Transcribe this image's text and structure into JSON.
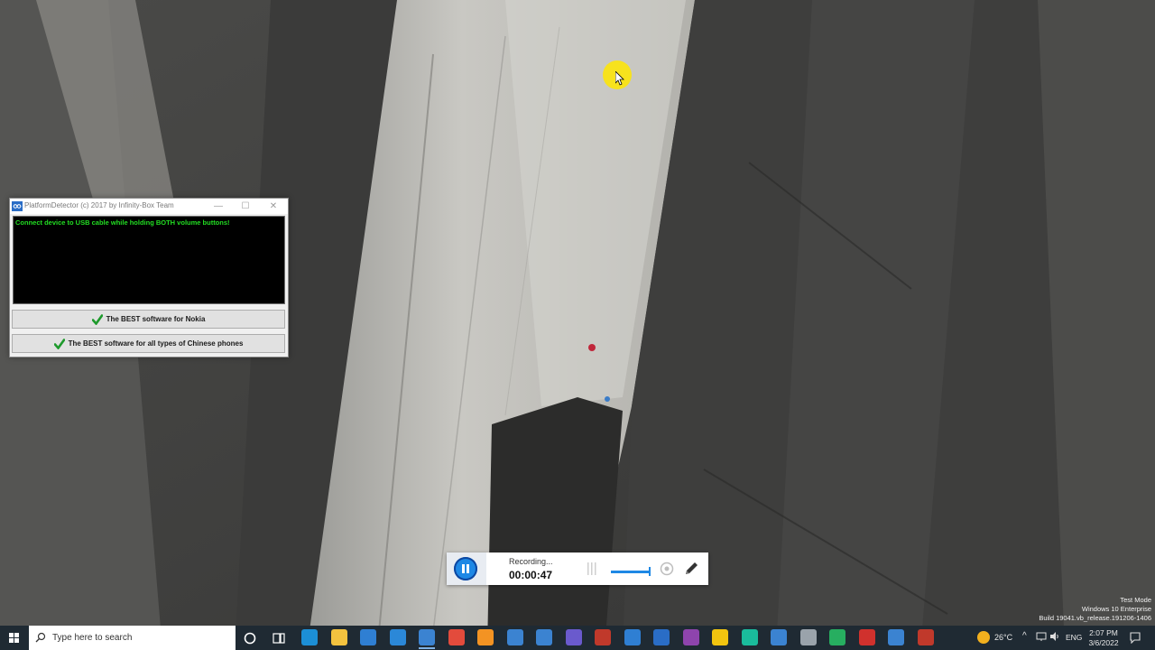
{
  "app_window": {
    "title": "PlatformDetector (c) 2017 by Infinity-Box Team",
    "console_message": "Connect device to USB cable while holding BOTH volume buttons!",
    "buttons": [
      {
        "label": "The BEST software for Nokia",
        "icon": "checkmark-icon"
      },
      {
        "label": "The BEST software for all types of Chinese phones",
        "icon": "checkmark-icon"
      }
    ],
    "controls": {
      "minimize": "—",
      "maximize": "☐",
      "close": "✕"
    }
  },
  "recorder": {
    "status_label": "Recording...",
    "elapsed_time": "00:00:47",
    "accent_color": "#1e88e5"
  },
  "watermark": {
    "line1": "Test Mode",
    "line2": "Windows 10 Enterprise",
    "line3": "Build 19041.vb_release.191206-1406"
  },
  "taskbar": {
    "search_placeholder": "Type here to search",
    "pinned_apps": [
      {
        "name": "edge-icon",
        "color": "#1c8fd6"
      },
      {
        "name": "file-explorer-icon",
        "color": "#f4c33f"
      },
      {
        "name": "store-icon",
        "color": "#2f7fd3"
      },
      {
        "name": "mail-icon",
        "color": "#2b88d8"
      },
      {
        "name": "infinity-app-icon",
        "color": "#3b83d1"
      },
      {
        "name": "chrome-icon",
        "color": "#e34b3c"
      },
      {
        "name": "search-app-icon",
        "color": "#f39323"
      },
      {
        "name": "infinity-app-icon",
        "color": "#3b83d1"
      },
      {
        "name": "infinity-app-icon",
        "color": "#3b83d1"
      },
      {
        "name": "app-icon",
        "color": "#6a5acd"
      },
      {
        "name": "app-icon",
        "color": "#c0392b"
      },
      {
        "name": "settings-icon",
        "color": "#2f7fd3"
      },
      {
        "name": "app-icon",
        "color": "#2a6dc6"
      },
      {
        "name": "app-icon",
        "color": "#8e44ad"
      },
      {
        "name": "app-icon",
        "color": "#f1c40f"
      },
      {
        "name": "app-icon",
        "color": "#1abc9c"
      },
      {
        "name": "infinity-app-icon",
        "color": "#3b83d1"
      },
      {
        "name": "tool-icon",
        "color": "#9aa3ab"
      },
      {
        "name": "app-icon",
        "color": "#27ae60"
      },
      {
        "name": "app-icon",
        "color": "#d0312d"
      },
      {
        "name": "infinity-app-icon",
        "color": "#3b83d1"
      },
      {
        "name": "app-icon",
        "color": "#c0392b"
      }
    ],
    "tray": {
      "temperature": "26°C",
      "chevron": "^",
      "language": "ENG",
      "time": "2:07 PM",
      "date": "3/6/2022"
    }
  }
}
